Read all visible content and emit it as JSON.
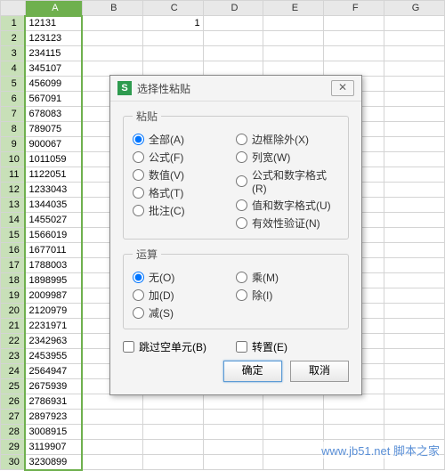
{
  "columns": [
    "",
    "A",
    "B",
    "C",
    "D",
    "E",
    "F",
    "G"
  ],
  "cellC1": "1",
  "rows": [
    {
      "n": 1,
      "a": "12131"
    },
    {
      "n": 2,
      "a": "123123"
    },
    {
      "n": 3,
      "a": "234115"
    },
    {
      "n": 4,
      "a": "345107"
    },
    {
      "n": 5,
      "a": "456099"
    },
    {
      "n": 6,
      "a": "567091"
    },
    {
      "n": 7,
      "a": "678083"
    },
    {
      "n": 8,
      "a": "789075"
    },
    {
      "n": 9,
      "a": "900067"
    },
    {
      "n": 10,
      "a": "1011059"
    },
    {
      "n": 11,
      "a": "1122051"
    },
    {
      "n": 12,
      "a": "1233043"
    },
    {
      "n": 13,
      "a": "1344035"
    },
    {
      "n": 14,
      "a": "1455027"
    },
    {
      "n": 15,
      "a": "1566019"
    },
    {
      "n": 16,
      "a": "1677011"
    },
    {
      "n": 17,
      "a": "1788003"
    },
    {
      "n": 18,
      "a": "1898995"
    },
    {
      "n": 19,
      "a": "2009987"
    },
    {
      "n": 20,
      "a": "2120979"
    },
    {
      "n": 21,
      "a": "2231971"
    },
    {
      "n": 22,
      "a": "2342963"
    },
    {
      "n": 23,
      "a": "2453955"
    },
    {
      "n": 24,
      "a": "2564947"
    },
    {
      "n": 25,
      "a": "2675939"
    },
    {
      "n": 26,
      "a": "2786931"
    },
    {
      "n": 27,
      "a": "2897923"
    },
    {
      "n": 28,
      "a": "3008915"
    },
    {
      "n": 29,
      "a": "3119907"
    },
    {
      "n": 30,
      "a": "3230899"
    }
  ],
  "dialog": {
    "title": "选择性粘贴",
    "group_paste": "粘贴",
    "group_op": "运算",
    "paste_left": [
      {
        "label": "全部(A)",
        "checked": true
      },
      {
        "label": "公式(F)",
        "checked": false
      },
      {
        "label": "数值(V)",
        "checked": false
      },
      {
        "label": "格式(T)",
        "checked": false
      },
      {
        "label": "批注(C)",
        "checked": false
      }
    ],
    "paste_right": [
      {
        "label": "边框除外(X)",
        "checked": false
      },
      {
        "label": "列宽(W)",
        "checked": false
      },
      {
        "label": "公式和数字格式(R)",
        "checked": false
      },
      {
        "label": "值和数字格式(U)",
        "checked": false
      },
      {
        "label": "有效性验证(N)",
        "checked": false
      }
    ],
    "op_left": [
      {
        "label": "无(O)",
        "checked": true
      },
      {
        "label": "加(D)",
        "checked": false
      },
      {
        "label": "减(S)",
        "checked": false
      }
    ],
    "op_right": [
      {
        "label": "乘(M)",
        "checked": false
      },
      {
        "label": "除(I)",
        "checked": false
      }
    ],
    "skip_blanks": "跳过空单元(B)",
    "transpose": "转置(E)",
    "ok": "确定",
    "cancel": "取消"
  },
  "watermark": "www.jb51.net  脚本之家"
}
